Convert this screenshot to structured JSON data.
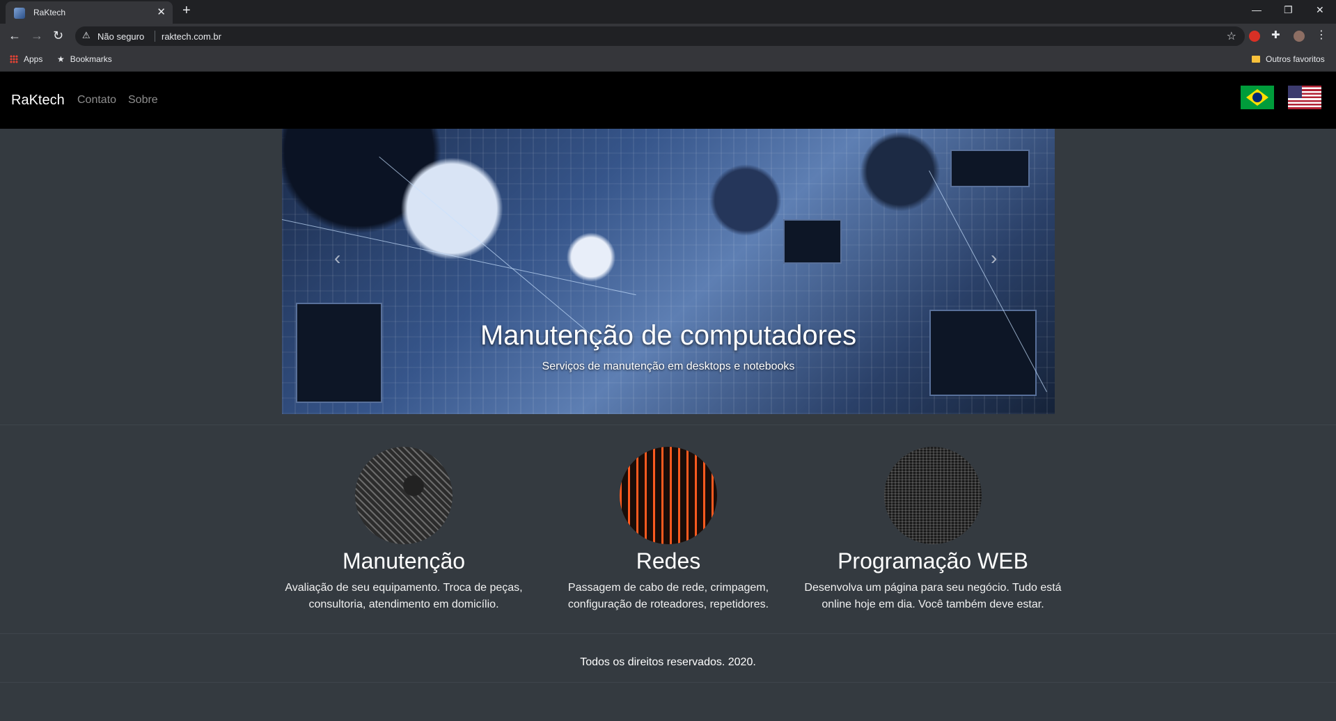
{
  "browser": {
    "tab_title": "RaKtech",
    "security_label": "Não seguro",
    "url": "raktech.com.br",
    "bookmarks": {
      "apps": "Apps",
      "bookmarks": "Bookmarks",
      "other": "Outros favoritos"
    }
  },
  "nav": {
    "brand": "RaKtech",
    "links": [
      "Contato",
      "Sobre"
    ]
  },
  "carousel": {
    "title": "Manutenção de computadores",
    "subtitle": "Serviços de manutenção em desktops e notebooks"
  },
  "features": [
    {
      "title": "Manutenção",
      "desc": "Avaliação de seu equipamento. Troca de peças, consultoria, atendimento em domicílio."
    },
    {
      "title": "Redes",
      "desc": "Passagem de cabo de rede, crimpagem, configuração de roteadores, repetidores."
    },
    {
      "title": "Programação WEB",
      "desc": "Desenvolva um página para seu negócio. Tudo está online hoje em dia. Você também deve estar."
    }
  ],
  "footer": {
    "text": "Todos os direitos reservados. 2020."
  }
}
